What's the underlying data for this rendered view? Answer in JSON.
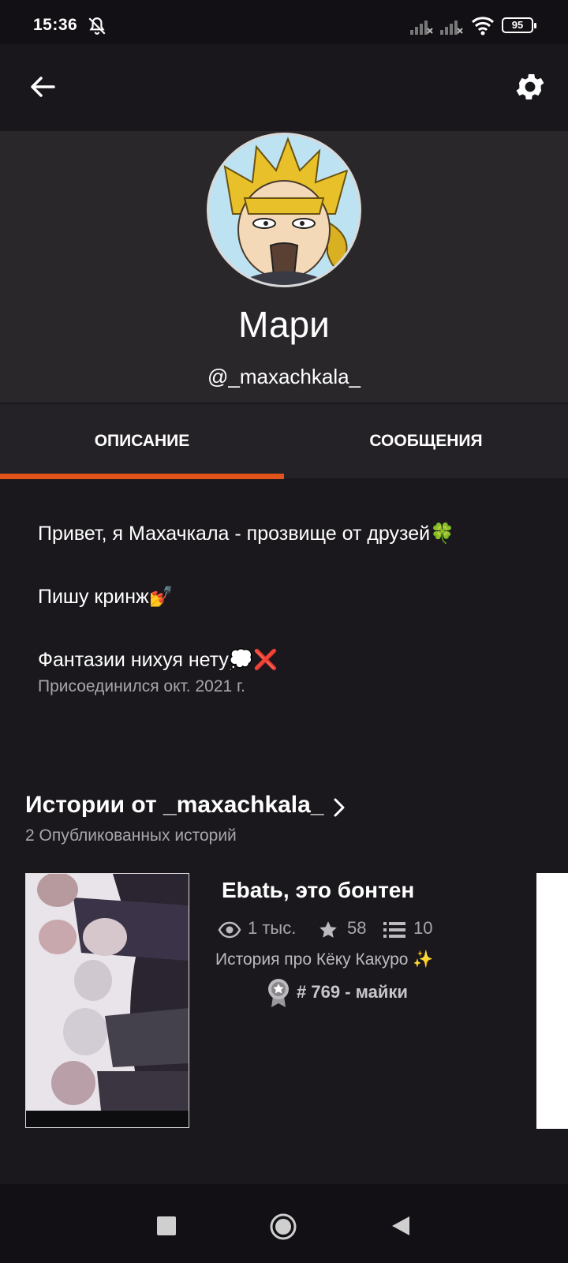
{
  "status_bar": {
    "time": "15:36",
    "battery": "95",
    "icons": [
      "bell-off-icon",
      "signal-icon",
      "signal-icon",
      "wifi-icon",
      "battery-icon"
    ]
  },
  "app_bar": {
    "back_icon": "arrow-left-icon",
    "settings_icon": "gear-icon"
  },
  "profile": {
    "name": "Мари",
    "username": "@_maxachkala_"
  },
  "tabs": [
    {
      "label": "ОПИСАНИЕ",
      "active": true
    },
    {
      "label": "СООБЩЕНИЯ",
      "active": false
    }
  ],
  "description": {
    "lines": [
      "Привет, я Махачкала - прозвище от друзей🍀",
      "Пишу кринж💅",
      "Фантазии нихуя нету💭❌"
    ],
    "joined": "Присоединился окт. 2021 г."
  },
  "stories": {
    "title": "Истории от _maxachkala_",
    "count_text": "2 Опубликованных историй",
    "items": [
      {
        "title": "Ebatь, это бонтен",
        "views": "1 тыс.",
        "votes": "58",
        "parts": "10",
        "description": "История про Кёку Какуро ✨",
        "rank": "# 769 - майки"
      }
    ]
  },
  "colors": {
    "accent": "#e0541b",
    "background": "#1a181c",
    "header": "#29272a",
    "muted_text": "#a9a6ab"
  },
  "nav_bar": {
    "icons": [
      "recents-square-icon",
      "home-circle-icon",
      "back-triangle-icon"
    ]
  }
}
